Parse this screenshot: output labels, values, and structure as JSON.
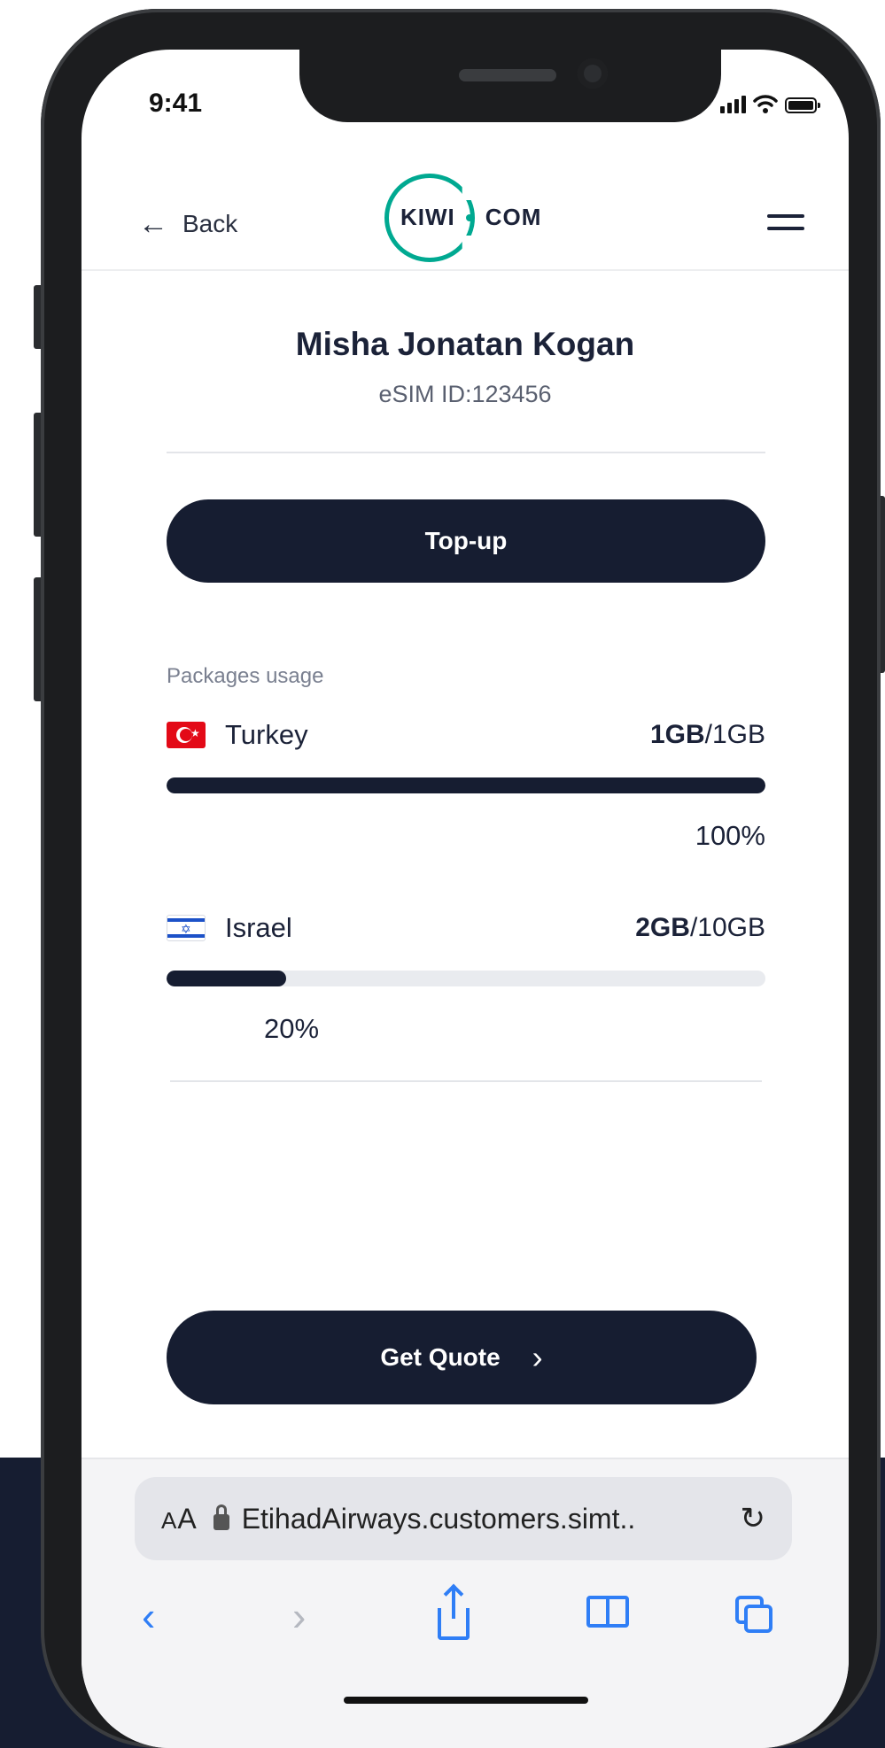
{
  "status_bar": {
    "time": "9:41"
  },
  "nav": {
    "back_label": "Back",
    "logo_left": "KIWI",
    "logo_right": "COM",
    "menu_icon": "hamburger-icon"
  },
  "profile": {
    "name": "Misha Jonatan Kogan",
    "esim_id": "eSIM ID:123456"
  },
  "actions": {
    "topup_label": "Top-up",
    "quote_label": "Get Quote"
  },
  "packages": {
    "title": "Packages usage",
    "items": [
      {
        "country": "Turkey",
        "flag": "turkey-flag",
        "used": "1GB",
        "total": "/1GB",
        "percent_label": "100%",
        "usage_fraction": 1.0
      },
      {
        "country": "Israel",
        "flag": "israel-flag",
        "used": "2GB",
        "total": "/10GB",
        "percent_label": "20%",
        "usage_fraction": 0.2
      }
    ]
  },
  "browser": {
    "aa_label": "A",
    "aa_big": "A",
    "url": "EtihadAirways.customers.simt..",
    "reload_icon": "reload-icon"
  },
  "colors": {
    "accent": "#00a991",
    "primary": "#161d31",
    "link_blue": "#2f7ef6"
  }
}
